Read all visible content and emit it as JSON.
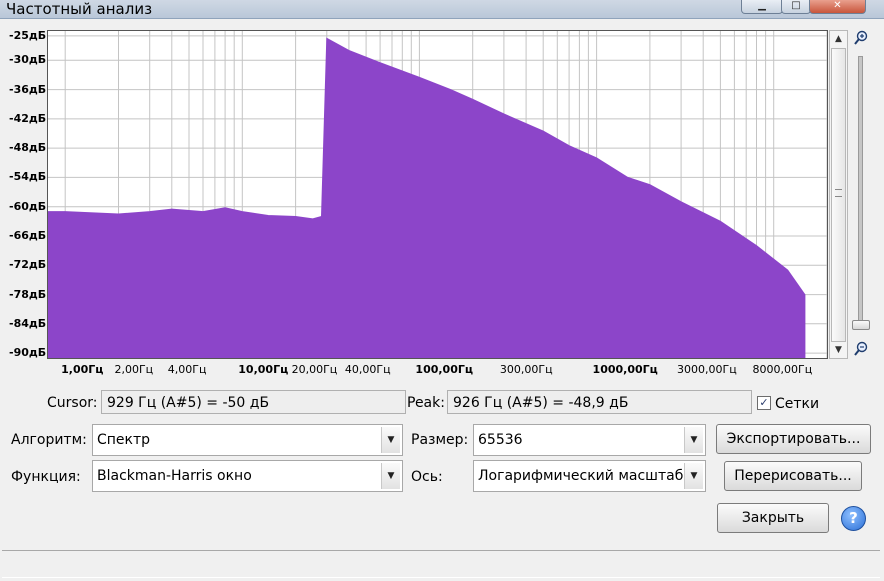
{
  "window": {
    "title": "Частотный анализ",
    "minimize_icon": "minimize-icon",
    "maximize_icon": "maximize-icon",
    "close_icon": "close-icon"
  },
  "plot": {
    "y_ticks": [
      "-25дБ",
      "-30дБ",
      "-36дБ",
      "-42дБ",
      "-48дБ",
      "-54дБ",
      "-60дБ",
      "-66дБ",
      "-72дБ",
      "-78дБ",
      "-84дБ",
      "-90дБ"
    ],
    "x_ticks": [
      {
        "text": "1,00Гц",
        "bold": true
      },
      {
        "text": "2,00Гц",
        "bold": false
      },
      {
        "text": "4,00Гц",
        "bold": false
      },
      {
        "text": "10,00Гц",
        "bold": true
      },
      {
        "text": "20,00Гц",
        "bold": false
      },
      {
        "text": "40,00Гц",
        "bold": false
      },
      {
        "text": "100,00Гц",
        "bold": true
      },
      {
        "text": "300,00Гц",
        "bold": false
      },
      {
        "text": "1000,00Гц",
        "bold": true
      },
      {
        "text": "3000,00Гц",
        "bold": false
      },
      {
        "text": "8000,00Гц",
        "bold": false
      }
    ],
    "fill_color": "#8c45c9",
    "grid": true,
    "zoom_in_icon": "zoom-in-icon",
    "zoom_out_icon": "zoom-out-icon"
  },
  "chart_data": {
    "type": "area",
    "xscale": "log",
    "xlim": [
      0.8,
      20000
    ],
    "ylim": [
      -91,
      -24
    ],
    "ylabel": "",
    "xlabel": "",
    "x": [
      0.8,
      1,
      2,
      3,
      4,
      6,
      8,
      10,
      14,
      20,
      25,
      28,
      30,
      40,
      60,
      100,
      150,
      200,
      300,
      500,
      700,
      1000,
      1500,
      2000,
      3000,
      5000,
      8000,
      12000,
      15000
    ],
    "y": [
      -61,
      -61,
      -61.5,
      -61,
      -60.5,
      -61,
      -60.2,
      -61,
      -61.8,
      -62,
      -62.5,
      -62,
      -25.5,
      -28,
      -30.5,
      -33.5,
      -36,
      -38,
      -41,
      -44.5,
      -47.5,
      -50,
      -54,
      -55.5,
      -59,
      -63,
      -68,
      -73,
      -78
    ]
  },
  "controls": {
    "cursor_label": "Cursor:",
    "cursor_value": "929 Гц (A#5) = -50 дБ",
    "peak_label": "Peak:",
    "peak_value": "926 Гц (A#5) = -48,9 дБ",
    "grid_checkbox_label": "Сетки",
    "grid_checked": true,
    "algorithm_label": "Алгоритм:",
    "algorithm_value": "Спектр",
    "size_label": "Размер:",
    "size_value": "65536",
    "function_label": "Функция:",
    "function_value": "Blackman-Harris окно",
    "axis_label": "Ось:",
    "axis_value": "Логарифмический масштаб",
    "export_button": "Экспортировать...",
    "redraw_button": "Перерисовать...",
    "close_button": "Закрыть",
    "help_icon": "help-icon",
    "help_glyph": "?"
  }
}
